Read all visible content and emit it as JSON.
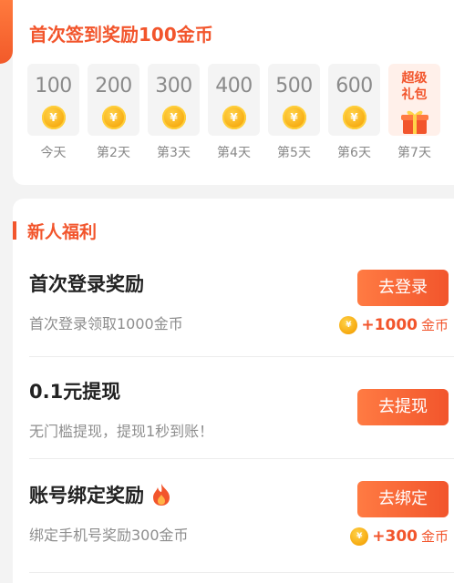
{
  "signin": {
    "title": "首次签到奖励100金币",
    "coin_glyph": "¥",
    "days": [
      {
        "value": "100",
        "label": "今天"
      },
      {
        "value": "200",
        "label": "第2天"
      },
      {
        "value": "300",
        "label": "第3天"
      },
      {
        "value": "400",
        "label": "第4天"
      },
      {
        "value": "500",
        "label": "第5天"
      },
      {
        "value": "600",
        "label": "第6天"
      }
    ],
    "gift_day": {
      "line1": "超级",
      "line2": "礼包",
      "label": "第7天"
    }
  },
  "welfare": {
    "title": "新人福利",
    "tasks": [
      {
        "title": "首次登录奖励",
        "desc": "首次登录领取1000金币",
        "button": "去登录",
        "reward_amount": "+1000",
        "reward_unit": "金币"
      },
      {
        "title": "0.1元提现",
        "desc": "无门槛提现，提现1秒到账！",
        "button": "去提现"
      },
      {
        "title": "账号绑定奖励",
        "desc": "绑定手机号奖励300金币",
        "button": "去绑定",
        "reward_amount": "+300",
        "reward_unit": "金币"
      }
    ]
  },
  "colors": {
    "accent": "#f2552c",
    "coin": "#f6a90f"
  }
}
